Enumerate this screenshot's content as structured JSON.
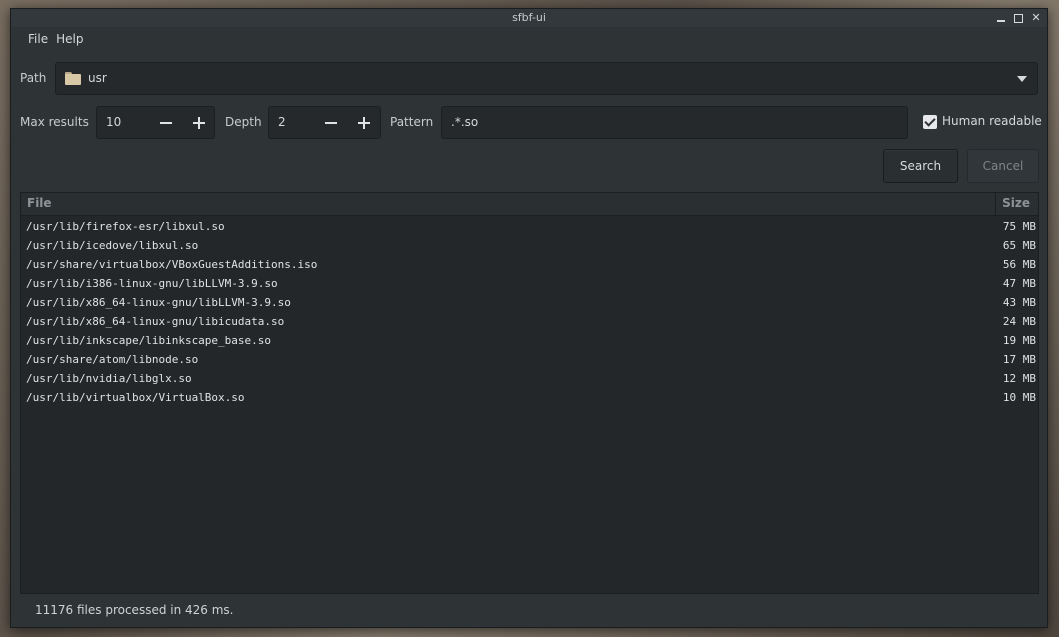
{
  "window": {
    "title": "sfbf-ui"
  },
  "menu": {
    "file": "File",
    "help": "Help"
  },
  "path": {
    "label": "Path",
    "value": "usr"
  },
  "max_results": {
    "label": "Max results",
    "value": "10"
  },
  "depth": {
    "label": "Depth",
    "value": "2"
  },
  "pattern": {
    "label": "Pattern",
    "value": ".*.so"
  },
  "human_readable": {
    "label": "Human readable",
    "checked": true
  },
  "buttons": {
    "search": "Search",
    "cancel": "Cancel"
  },
  "table": {
    "columns": {
      "file": "File",
      "size": "Size"
    },
    "rows": [
      {
        "file": "/usr/lib/firefox-esr/libxul.so",
        "size": "75 MB"
      },
      {
        "file": "/usr/lib/icedove/libxul.so",
        "size": "65 MB"
      },
      {
        "file": "/usr/share/virtualbox/VBoxGuestAdditions.iso",
        "size": "56 MB"
      },
      {
        "file": "/usr/lib/i386-linux-gnu/libLLVM-3.9.so",
        "size": "47 MB"
      },
      {
        "file": "/usr/lib/x86_64-linux-gnu/libLLVM-3.9.so",
        "size": "43 MB"
      },
      {
        "file": "/usr/lib/x86_64-linux-gnu/libicudata.so",
        "size": "24 MB"
      },
      {
        "file": "/usr/lib/inkscape/libinkscape_base.so",
        "size": "19 MB"
      },
      {
        "file": "/usr/share/atom/libnode.so",
        "size": "17 MB"
      },
      {
        "file": "/usr/lib/nvidia/libglx.so",
        "size": "12 MB"
      },
      {
        "file": "/usr/lib/virtualbox/VirtualBox.so",
        "size": "10 MB"
      }
    ]
  },
  "status": {
    "text": "11176 files processed in 426 ms."
  }
}
